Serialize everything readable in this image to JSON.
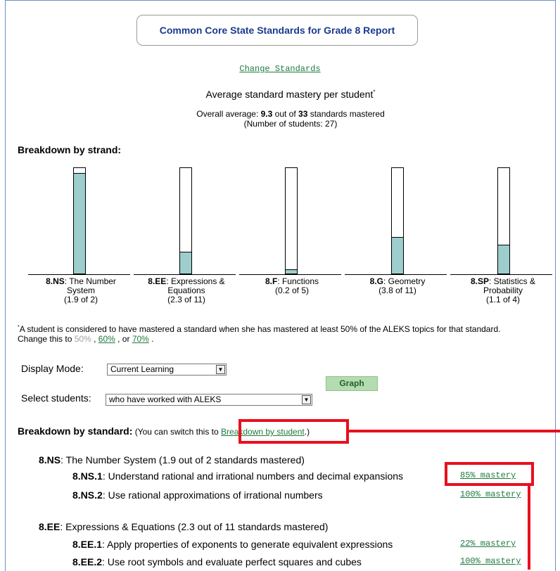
{
  "report": {
    "title": "Common Core State Standards for Grade 8 Report",
    "change_standards": "Change Standards",
    "avg_heading": "Average standard mastery per student",
    "avg_star": "*",
    "overall_prefix": "Overall average: ",
    "overall_value": "9.3",
    "overall_mid": " out of ",
    "overall_total": "33",
    "overall_suffix": " standards mastered",
    "students_line": "(Number of students: 27)"
  },
  "strand_heading": "Breakdown by strand:",
  "chart_data": {
    "type": "bar",
    "categories": [
      "8.NS",
      "8.EE",
      "8.F",
      "8.G",
      "8.SP"
    ],
    "names": [
      "The Number System",
      "Expressions & Equations",
      "Functions",
      "Geometry",
      "Statistics & Probability"
    ],
    "mastered": [
      1.9,
      2.3,
      0.2,
      3.8,
      1.1
    ],
    "totals": [
      2,
      11,
      5,
      11,
      4
    ],
    "values_fraction": [
      0.95,
      0.209,
      0.04,
      0.345,
      0.275
    ],
    "ylim": [
      0,
      1
    ],
    "fill_color": "#9dcdcc"
  },
  "strands": [
    {
      "code": "8.NS",
      "line1": ": The Number",
      "line2": "System",
      "line3": "(1.9 of 2)"
    },
    {
      "code": "8.EE",
      "line1": ": Expressions &",
      "line2": "Equations",
      "line3": "(2.3 of 11)"
    },
    {
      "code": "8.F",
      "line1": ": Functions",
      "line2": "(0.2 of 5)",
      "line3": ""
    },
    {
      "code": "8.G",
      "line1": ": Geometry",
      "line2": "(3.8 of 11)",
      "line3": ""
    },
    {
      "code": "8.SP",
      "line1": ": Statistics &",
      "line2": "Probability",
      "line3": "(1.1 of 4)"
    }
  ],
  "footnote": {
    "star": "*",
    "text": "A student is considered to have mastered a standard when she has mastered at least 50% of the ALEKS topics for that standard.",
    "change_prefix": "Change this to ",
    "opt50": "50%",
    "sep1": " , ",
    "opt60": "60%",
    "sep2": " , or ",
    "opt70": "70%",
    "end": " ."
  },
  "controls": {
    "display_mode_label": "Display Mode:",
    "display_mode_value": "Current Learning",
    "select_students_label": "Select students:",
    "select_students_value": "who have worked with ALEKS",
    "graph_button": "Graph",
    "dropdown_arrow": "▼"
  },
  "standard_breakdown": {
    "heading": "Breakdown by standard:",
    "note_prefix": " (You can switch this to ",
    "note_link": "Breakdown by student",
    "note_suffix": ".)"
  },
  "groups": [
    {
      "code": "8.NS",
      "title": ": The Number System (1.9 out of 2 standards mastered)",
      "items": [
        {
          "code": "8.NS.1",
          "text": ": Understand rational and irrational numbers and decimal expansions",
          "mastery": "85% mastery"
        },
        {
          "code": "8.NS.2",
          "text": ": Use rational approximations of irrational numbers",
          "mastery": "100% mastery"
        }
      ]
    },
    {
      "code": "8.EE",
      "title": ": Expressions & Equations (2.3 out of 11 standards mastered)",
      "items": [
        {
          "code": "8.EE.1",
          "text": ": Apply properties of exponents to generate equivalent expressions",
          "mastery": "22% mastery"
        },
        {
          "code": "8.EE.2",
          "text": ": Use root symbols and evaluate perfect squares and cubes",
          "mastery": "100% mastery"
        }
      ]
    }
  ],
  "highlight_color": "#e8101e"
}
